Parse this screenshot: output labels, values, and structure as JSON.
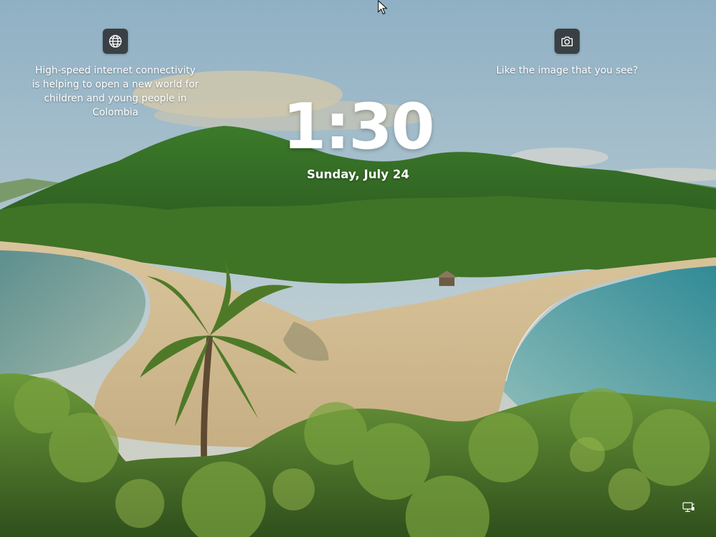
{
  "lockscreen": {
    "time": "1:30",
    "date": "Sunday, July 24"
  },
  "spotlight": {
    "info": {
      "icon": "globe-icon",
      "text": "High-speed internet connectivity is helping to open a new world for children and young people in Colombia"
    },
    "like": {
      "icon": "camera-icon",
      "text": "Like the image that you see?"
    }
  },
  "tray": {
    "network_icon": "network-icon"
  },
  "colors": {
    "button_bg": "#202020",
    "text": "#ffffff"
  }
}
